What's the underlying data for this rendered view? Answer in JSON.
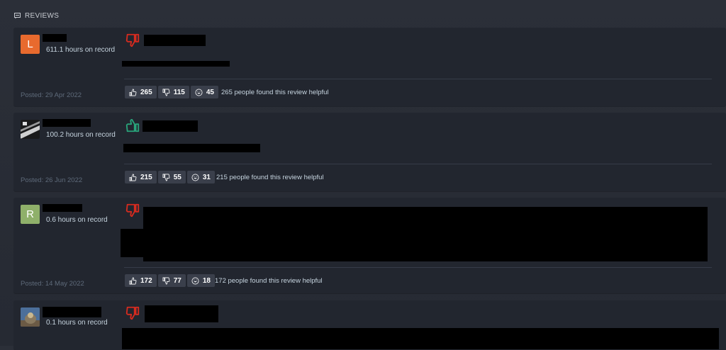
{
  "section": {
    "title": "REVIEWS",
    "icon": "comment-icon"
  },
  "reviews": [
    {
      "avatar_letter": "L",
      "avatar_color": "#e86a2e",
      "hours": "611.1 hours on record",
      "posted": "Posted: 29 Apr 2022",
      "recommended": false,
      "upvotes": "265",
      "downvotes": "115",
      "funny": "45",
      "helpful": "265 people found this review helpful"
    },
    {
      "avatar_letter": "",
      "avatar_color": "#4a4f55",
      "hours": "100.2 hours on record",
      "posted": "Posted: 26 Jun 2022",
      "recommended": true,
      "upvotes": "215",
      "downvotes": "55",
      "funny": "31",
      "helpful": "215 people found this review helpful"
    },
    {
      "avatar_letter": "R",
      "avatar_color": "#8fb06a",
      "hours": "0.6 hours on record",
      "posted": "Posted: 14 May 2022",
      "recommended": false,
      "upvotes": "172",
      "downvotes": "77",
      "funny": "18",
      "helpful": "172 people found this review helpful"
    },
    {
      "avatar_letter": "",
      "avatar_color": "#5a6a7a",
      "hours": "0.1 hours on record",
      "recommended": false
    }
  ],
  "colors": {
    "thumb_down": "#d62b1f",
    "thumb_up": "#29a37a"
  }
}
